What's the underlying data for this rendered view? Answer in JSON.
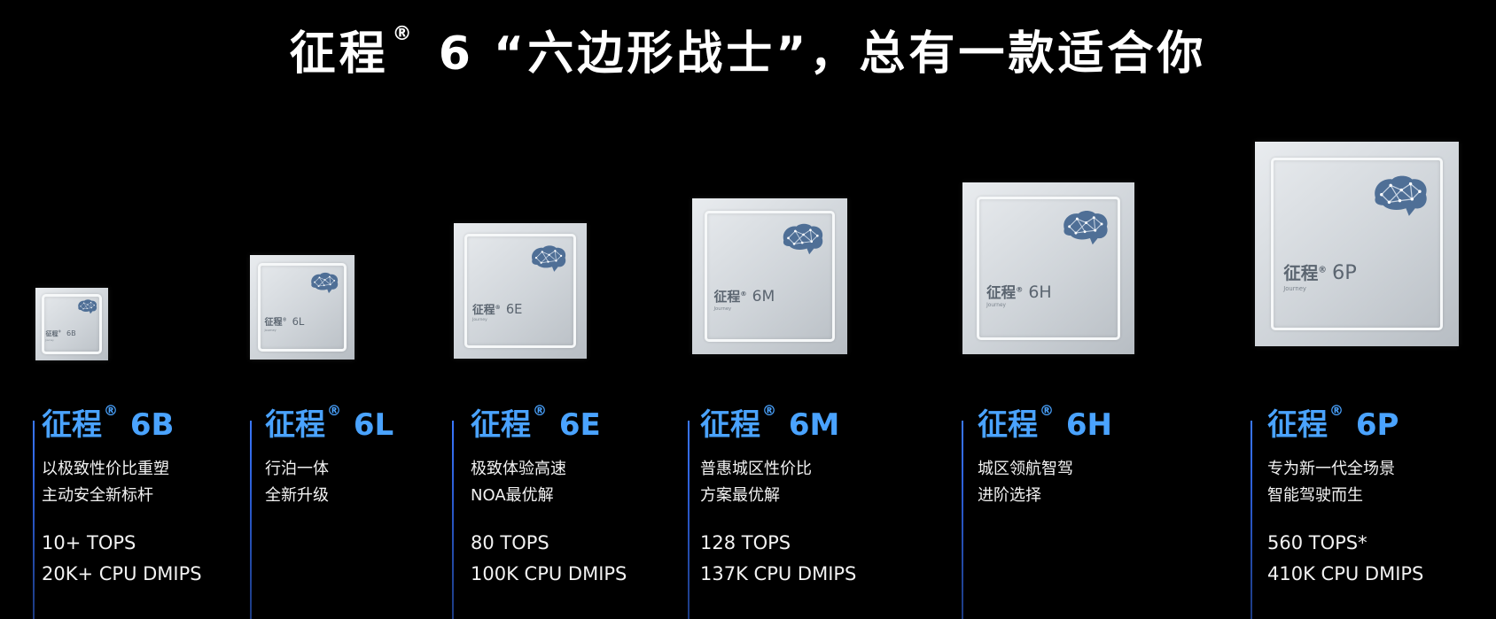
{
  "headline": {
    "brand": "征程",
    "reg": "®",
    "rest": " 6 “六边形战士”，总有一款适合你"
  },
  "chip_brand": "征程",
  "chip_reg": "®",
  "chip_sub": "Journey",
  "chips": [
    {
      "model": "6B"
    },
    {
      "model": "6L"
    },
    {
      "model": "6E"
    },
    {
      "model": "6M"
    },
    {
      "model": "6H"
    },
    {
      "model": "6P"
    }
  ],
  "cards": [
    {
      "brand": "征程",
      "reg": "®",
      "model": "6B",
      "desc": [
        "以极致性价比重塑",
        "主动安全新标杆"
      ],
      "tops": "10+ TOPS",
      "dmips": "20K+ CPU DMIPS"
    },
    {
      "brand": "征程",
      "reg": "®",
      "model": "6L",
      "desc": [
        "行泊一体",
        "全新升级"
      ],
      "tops": "",
      "dmips": ""
    },
    {
      "brand": "征程",
      "reg": "®",
      "model": "6E",
      "desc": [
        "极致体验高速",
        "NOA最优解"
      ],
      "tops": "80 TOPS",
      "dmips": "100K CPU DMIPS"
    },
    {
      "brand": "征程",
      "reg": "®",
      "model": "6M",
      "desc": [
        "普惠城区性价比",
        "方案最优解"
      ],
      "tops": "128 TOPS",
      "dmips": "137K CPU DMIPS"
    },
    {
      "brand": "征程",
      "reg": "®",
      "model": "6H",
      "desc": [
        "城区领航智驾",
        "进阶选择"
      ],
      "tops": "",
      "dmips": ""
    },
    {
      "brand": "征程",
      "reg": "®",
      "model": "6P",
      "desc": [
        "专为新一代全场景",
        "智能驾驶而生"
      ],
      "tops": "560 TOPS*",
      "dmips": "410K CPU DMIPS"
    }
  ],
  "colors": {
    "background": "#000000",
    "accent_title": "#4aa3ff",
    "timeline": "#3a78ff",
    "logo": "#4f6f96"
  },
  "icons": {
    "chip_logo": "brain-network-icon"
  }
}
